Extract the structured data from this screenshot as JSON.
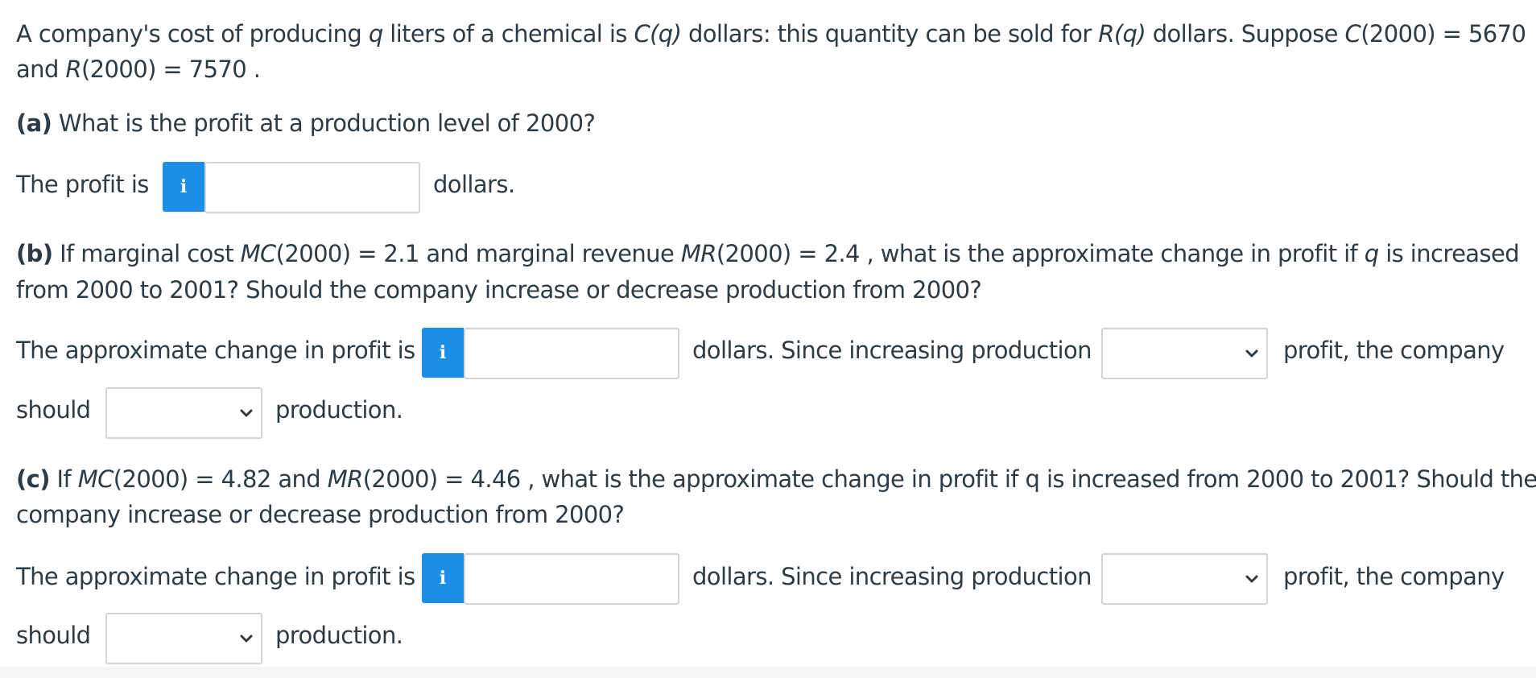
{
  "intro": {
    "l1_a": "A company's cost of producing ",
    "l1_q": "q",
    "l1_b": " liters of a chemical is ",
    "l1_Cq": "C(q)",
    "l1_c": " dollars: this quantity can be sold for ",
    "l1_Rq": "R(q)",
    "l1_d": " dollars. Suppose ",
    "l1_C": "C",
    "l1_e": "(2000) = 5670",
    "l2_a": "and ",
    "l2_R": "R",
    "l2_b": "(2000) = 7570 ."
  },
  "part_a": {
    "label": "(a)",
    "question": " What is the profit at a production level of 2000?",
    "answer_prefix": "The profit is",
    "info_icon": "i",
    "answer_value": "",
    "answer_suffix": "dollars."
  },
  "part_b": {
    "label": "(b)",
    "q1_a": " If marginal cost ",
    "q1_MC": "MC",
    "q1_b": "(2000) = 2.1 and marginal revenue ",
    "q1_MR": "MR",
    "q1_c": "(2000) = 2.4 , what is the approximate change in profit if ",
    "q1_q": "q",
    "q1_d": " is increased",
    "q2": "from 2000 to 2001? Should the company increase or decrease production from 2000?",
    "prefix": "The approximate change in profit is",
    "info_icon": "i",
    "answer_value": "",
    "mid": "dollars. Since increasing production",
    "select1_value": "",
    "suffix": "profit, the company",
    "should": "should",
    "select2_value": "",
    "end": "production."
  },
  "part_c": {
    "label": "(c)",
    "q1_a": " If ",
    "q1_MC": "MC",
    "q1_b": "(2000) = 4.82 and ",
    "q1_MR": "MR",
    "q1_c": "(2000) = 4.46 , what is the approximate change in profit if q is increased from 2000 to 2001? Should the",
    "q2": "company increase or decrease production from 2000?",
    "prefix": "The approximate change in profit is",
    "info_icon": "i",
    "answer_value": "",
    "mid": "dollars. Since increasing production",
    "select1_value": "",
    "suffix": "profit, the company",
    "should": "should",
    "select2_value": "",
    "end": "production."
  },
  "colors": {
    "text": "#2d3b45",
    "info_button": "#1d8ee6",
    "border": "#cfd5d9"
  },
  "icons": {
    "info": "info-icon",
    "dropdown": "chevron-down-icon"
  }
}
